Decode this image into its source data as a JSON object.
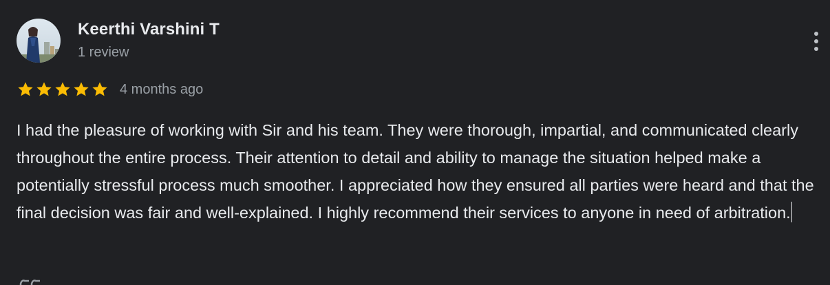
{
  "reviewer": {
    "name": "Keerthi Varshini T",
    "review_count": "1 review",
    "avatar": "profile-photo"
  },
  "rating": {
    "stars": 5,
    "max_stars": 5,
    "star_color": "#fbbc04",
    "time": "4 months ago"
  },
  "review": {
    "text": "I had the pleasure of working with Sir and his team. They were thorough, impartial, and communicated clearly throughout the entire process. Their attention to detail and ability to manage the situation helped make a potentially stressful process much smoother. I appreciated how they ensured all parties were heard and that the final decision was fair and well-explained. I highly recommend their services to anyone in need of arbitration."
  },
  "icons": {
    "more": "more-vert-icon",
    "star": "star-icon"
  },
  "colors": {
    "background": "#202124",
    "primary_text": "#e8eaed",
    "secondary_text": "#9aa0a6"
  }
}
